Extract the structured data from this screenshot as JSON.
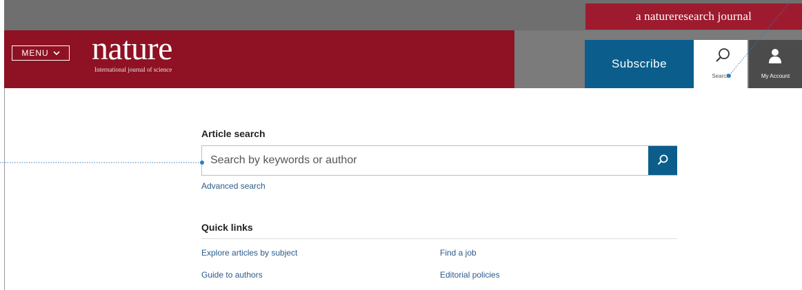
{
  "header": {
    "brand_tagline": "a natureresearch journal",
    "menu_label": "MENU",
    "logo_text": "nature",
    "logo_subtitle": "International journal of science",
    "subscribe_label": "Subscribe",
    "search_label": "Search",
    "account_label": "My Account"
  },
  "article_search": {
    "heading": "Article search",
    "placeholder": "Search by keywords or author",
    "advanced_link": "Advanced search"
  },
  "quick_links": {
    "heading": "Quick links",
    "items": [
      {
        "label": "Explore articles by subject"
      },
      {
        "label": "Find a job"
      },
      {
        "label": "Guide to authors"
      },
      {
        "label": "Editorial policies"
      }
    ]
  },
  "colors": {
    "brand_red": "#8e1223",
    "brand_red_light": "#9e1b2f",
    "subscribe_blue": "#0b5e8c",
    "callout_blue": "#2f7dbf"
  },
  "icons": [
    "chevron-down-icon",
    "search-icon",
    "user-icon"
  ]
}
